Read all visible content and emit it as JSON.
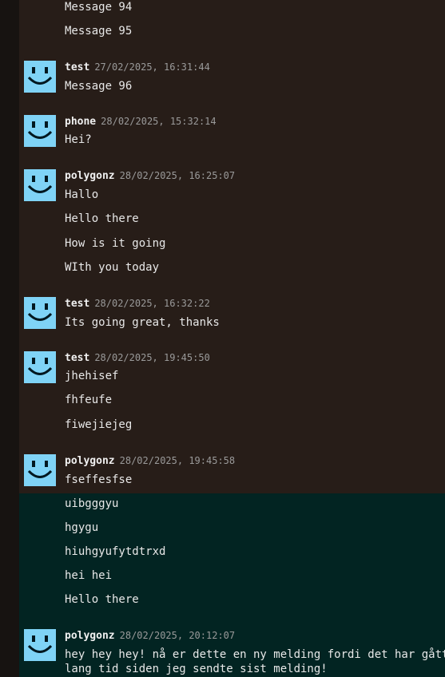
{
  "colors": {
    "avatar_bg": "#7fd3f6",
    "avatar_face": "#001820",
    "highlight_bg": "#022422"
  },
  "messages": [
    {
      "text": "Message 94"
    },
    {
      "text": "Message 95"
    },
    {
      "author": "test",
      "timestamp": "27/02/2025, 16:31:44",
      "text": "Message 96"
    },
    {
      "author": "phone",
      "timestamp": "28/02/2025, 15:32:14",
      "text": "Hei?"
    },
    {
      "author": "polygonz",
      "timestamp": "28/02/2025, 16:25:07",
      "text": "Hallo"
    },
    {
      "text": "Hello there"
    },
    {
      "text": "How is it going"
    },
    {
      "text": "WIth you today"
    },
    {
      "author": "test",
      "timestamp": "28/02/2025, 16:32:22",
      "text": "Its going great, thanks"
    },
    {
      "author": "test",
      "timestamp": "28/02/2025, 19:45:50",
      "text": "jhehisef"
    },
    {
      "text": "fhfeufe"
    },
    {
      "text": "fiwejiejeg"
    },
    {
      "author": "polygonz",
      "timestamp": "28/02/2025, 19:45:58",
      "text": "fseffesfse"
    },
    {
      "text": "uibgggyu"
    },
    {
      "text": "hgygu"
    },
    {
      "text": "hiuhgyufytdtrxd"
    },
    {
      "text": "hei hei"
    },
    {
      "text": "Hello there"
    },
    {
      "author": "polygonz",
      "timestamp": "28/02/2025, 20:12:07",
      "text": "hey hey hey! nå er dette en ny melding fordi det har gått lang tid siden jeg sendte sist melding!"
    }
  ]
}
